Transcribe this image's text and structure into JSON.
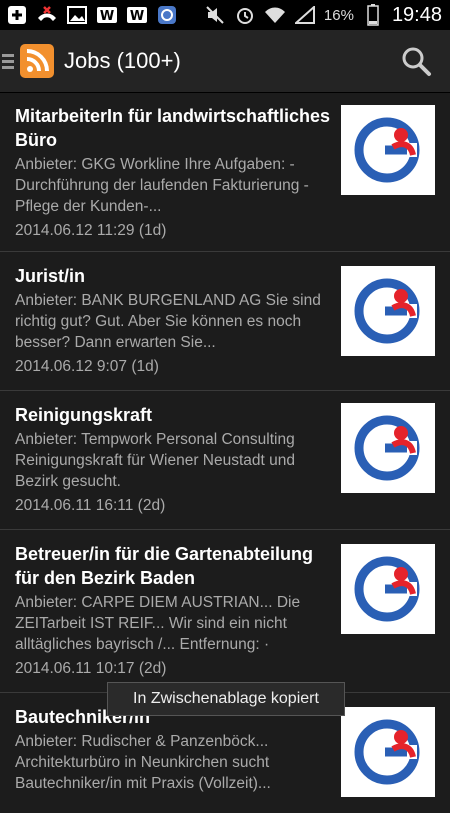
{
  "statusbar": {
    "battery": "16%",
    "time": "19:48",
    "icons": [
      "plus-icon",
      "missed-call-icon",
      "picture-icon",
      "w-icon",
      "w-icon",
      "app-icon",
      "mute-icon",
      "alarm-icon",
      "wifi-icon",
      "signal-icon",
      "battery-icon"
    ]
  },
  "actionbar": {
    "title": "Jobs (100+)"
  },
  "jobs": [
    {
      "title": "MitarbeiterIn für landwirtschaftliches Büro",
      "desc": "Anbieter: GKG Workline Ihre Aufgaben: - Durchführung der laufenden Fakturierung -Pflege der Kunden-...",
      "date": "2014.06.12 11:29 (1d)"
    },
    {
      "title": "Jurist/in",
      "desc": "Anbieter: BANK BURGENLAND AG Sie sind richtig gut? Gut. Aber Sie können es noch besser? Dann erwarten Sie...",
      "date": "2014.06.12 9:07 (1d)"
    },
    {
      "title": "Reinigungskraft",
      "desc": "Anbieter: Tempwork Personal Consulting Reinigungskraft für Wiener Neustadt und Bezirk gesucht.",
      "date": "2014.06.11 16:11 (2d)"
    },
    {
      "title": "Betreuer/in für die Gartenabteilung für den Bezirk Baden",
      "desc": "Anbieter: CARPE DIEM AUSTRIAN... Die ZEITarbeit IST REIF... Wir sind ein nicht alltägliches bayrisch /... Entfernung: ·",
      "date": "2014.06.11 10:17 (2d)"
    },
    {
      "title": "Bautechniker/in",
      "desc": "Anbieter: Rudischer & Panzenböck... Architekturbüro in Neunkirchen sucht Bautechniker/in mit Praxis (Vollzeit)...",
      "date": ""
    }
  ],
  "toast": "In Zwischenablage kopiert",
  "colors": {
    "accent": "#f2902e",
    "logo_blue": "#2a5fb5",
    "logo_red": "#e5232b"
  }
}
